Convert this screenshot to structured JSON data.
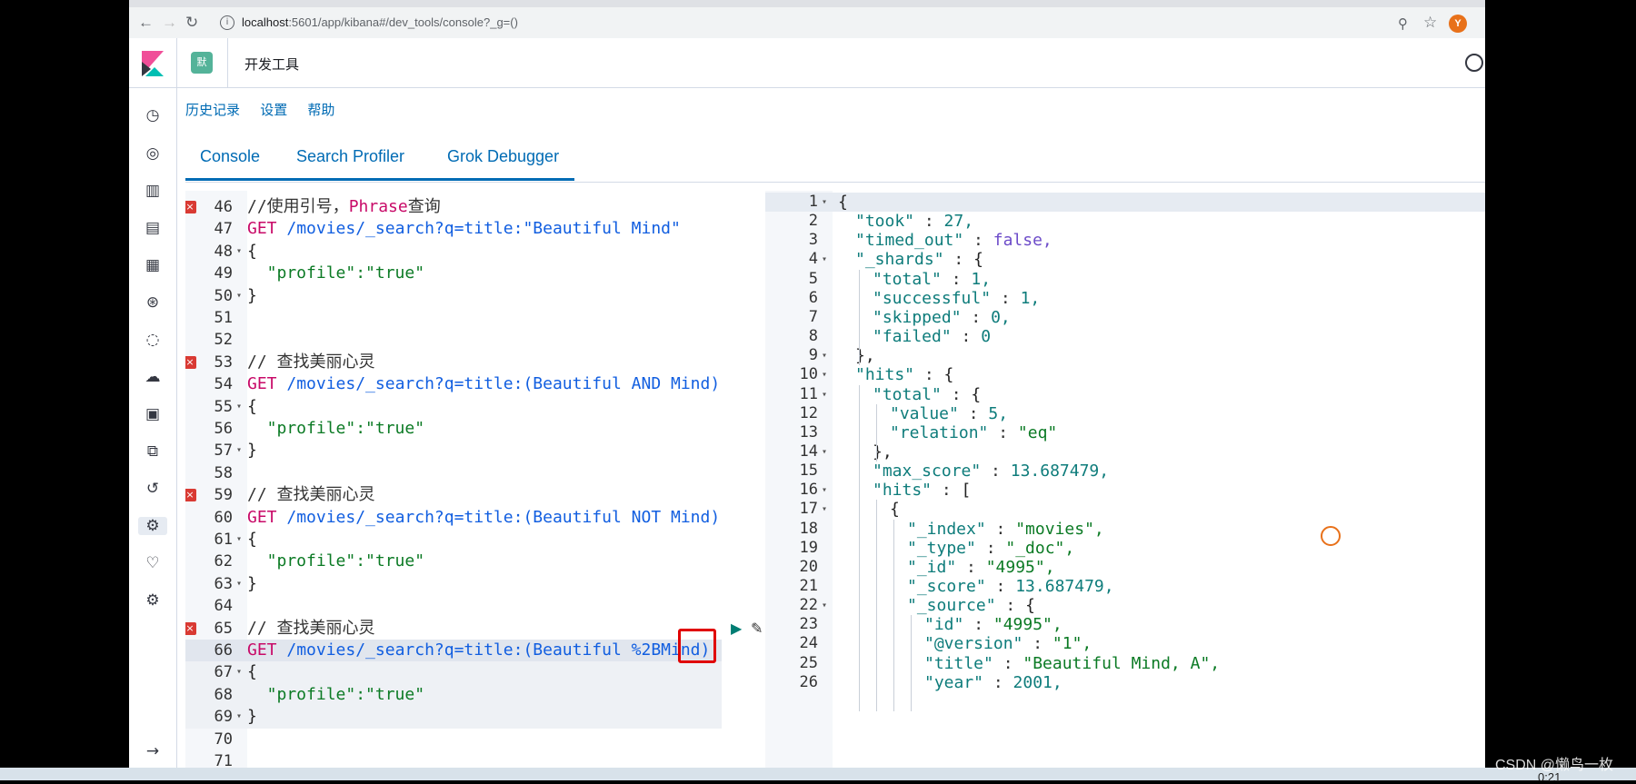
{
  "browser": {
    "url_host": "localhost",
    "url_path": ":5601/app/kibana#/dev_tools/console?_g=()",
    "avatar_letter": "Y"
  },
  "header": {
    "space_badge": "默",
    "title": "开发工具"
  },
  "top_menu": [
    "历史记录",
    "设置",
    "帮助"
  ],
  "tabs": [
    "Console",
    "Search Profiler",
    "Grok Debugger"
  ],
  "editor_left": {
    "lines": [
      {
        "n": "46",
        "text": "//使用引号，",
        "extra": "Phrase",
        "tail": "查询",
        "type": "comment_phrase",
        "err": true
      },
      {
        "n": "47",
        "get": "GET ",
        "url": "/movies/_search?q=title:\"Beautiful Mind\"",
        "type": "req"
      },
      {
        "n": "48",
        "text": "{",
        "type": "plain",
        "fold": true
      },
      {
        "n": "49",
        "text": "  \"profile\":\"true\"",
        "type": "kv"
      },
      {
        "n": "50",
        "text": "}",
        "type": "plain",
        "fold": true
      },
      {
        "n": "51",
        "text": "",
        "type": "plain"
      },
      {
        "n": "52",
        "text": "",
        "type": "plain"
      },
      {
        "n": "53",
        "text": "// 查找美丽心灵",
        "type": "comment",
        "err": true
      },
      {
        "n": "54",
        "get": "GET ",
        "url": "/movies/_search?q=title:(Beautiful AND Mind)",
        "type": "req"
      },
      {
        "n": "55",
        "text": "{",
        "type": "plain",
        "fold": true
      },
      {
        "n": "56",
        "text": "  \"profile\":\"true\"",
        "type": "kv"
      },
      {
        "n": "57",
        "text": "}",
        "type": "plain",
        "fold": true
      },
      {
        "n": "58",
        "text": "",
        "type": "plain"
      },
      {
        "n": "59",
        "text": "// 查找美丽心灵",
        "type": "comment",
        "err": true
      },
      {
        "n": "60",
        "get": "GET ",
        "url": "/movies/_search?q=title:(Beautiful NOT Mind)",
        "type": "req"
      },
      {
        "n": "61",
        "text": "{",
        "type": "plain",
        "fold": true
      },
      {
        "n": "62",
        "text": "  \"profile\":\"true\"",
        "type": "kv"
      },
      {
        "n": "63",
        "text": "}",
        "type": "plain",
        "fold": true
      },
      {
        "n": "64",
        "text": "",
        "type": "plain"
      },
      {
        "n": "65",
        "text": "// 查找美丽心灵",
        "type": "comment",
        "err": true
      },
      {
        "n": "66",
        "get": "GET ",
        "url": "/movies/_search?q=title:(Beautiful %2BMind)",
        "type": "req"
      },
      {
        "n": "67",
        "text": "{",
        "type": "plain",
        "fold": true
      },
      {
        "n": "68",
        "text": "  \"profile\":\"true\"",
        "type": "kv"
      },
      {
        "n": "69",
        "text": "}",
        "type": "plain",
        "fold": true
      },
      {
        "n": "70",
        "text": "",
        "type": "plain"
      },
      {
        "n": "71",
        "text": "",
        "type": "plain"
      }
    ]
  },
  "editor_right": {
    "lines": [
      {
        "n": "1",
        "text": "{",
        "fold": true
      },
      {
        "n": "2",
        "key": "\"took\"",
        "val": "27",
        "vt": "num",
        "indent": 1
      },
      {
        "n": "3",
        "key": "\"timed_out\"",
        "val": "false",
        "vt": "bool",
        "indent": 1
      },
      {
        "n": "4",
        "key": "\"_shards\"",
        "val": "{",
        "vt": "plain",
        "indent": 1,
        "fold": true,
        "nocomma": true
      },
      {
        "n": "5",
        "key": "\"total\"",
        "val": "1",
        "vt": "num",
        "indent": 2
      },
      {
        "n": "6",
        "key": "\"successful\"",
        "val": "1",
        "vt": "num",
        "indent": 2
      },
      {
        "n": "7",
        "key": "\"skipped\"",
        "val": "0",
        "vt": "num",
        "indent": 2
      },
      {
        "n": "8",
        "key": "\"failed\"",
        "val": "0",
        "vt": "num",
        "indent": 2,
        "nocomma": true
      },
      {
        "n": "9",
        "text": "},",
        "indent": 1,
        "fold": true
      },
      {
        "n": "10",
        "key": "\"hits\"",
        "val": "{",
        "vt": "plain",
        "indent": 1,
        "fold": true,
        "nocomma": true
      },
      {
        "n": "11",
        "key": "\"total\"",
        "val": "{",
        "vt": "plain",
        "indent": 2,
        "fold": true,
        "nocomma": true
      },
      {
        "n": "12",
        "key": "\"value\"",
        "val": "5",
        "vt": "num",
        "indent": 3
      },
      {
        "n": "13",
        "key": "\"relation\"",
        "val": "\"eq\"",
        "vt": "str",
        "indent": 3,
        "nocomma": true
      },
      {
        "n": "14",
        "text": "},",
        "indent": 2,
        "fold": true
      },
      {
        "n": "15",
        "key": "\"max_score\"",
        "val": "13.687479",
        "vt": "num",
        "indent": 2
      },
      {
        "n": "16",
        "key": "\"hits\"",
        "val": "[",
        "vt": "plain",
        "indent": 2,
        "fold": true,
        "nocomma": true
      },
      {
        "n": "17",
        "text": "{",
        "indent": 3,
        "fold": true
      },
      {
        "n": "18",
        "key": "\"_index\"",
        "val": "\"movies\"",
        "vt": "str",
        "indent": 4
      },
      {
        "n": "19",
        "key": "\"_type\"",
        "val": "\"_doc\"",
        "vt": "str",
        "indent": 4
      },
      {
        "n": "20",
        "key": "\"_id\"",
        "val": "\"4995\"",
        "vt": "str",
        "indent": 4
      },
      {
        "n": "21",
        "key": "\"_score\"",
        "val": "13.687479",
        "vt": "num",
        "indent": 4
      },
      {
        "n": "22",
        "key": "\"_source\"",
        "val": "{",
        "vt": "plain",
        "indent": 4,
        "fold": true,
        "nocomma": true
      },
      {
        "n": "23",
        "key": "\"id\"",
        "val": "\"4995\"",
        "vt": "str",
        "indent": 5
      },
      {
        "n": "24",
        "key": "\"@version\"",
        "val": "\"1\"",
        "vt": "str",
        "indent": 5
      },
      {
        "n": "25",
        "key": "\"title\"",
        "val": "\"Beautiful Mind, A\"",
        "vt": "str",
        "indent": 5
      },
      {
        "n": "26",
        "key": "\"year\"",
        "val": "2001",
        "vt": "num",
        "indent": 5
      }
    ]
  },
  "watermark": "CSDN @懒鸟一枚",
  "bottom_time": "0:21"
}
